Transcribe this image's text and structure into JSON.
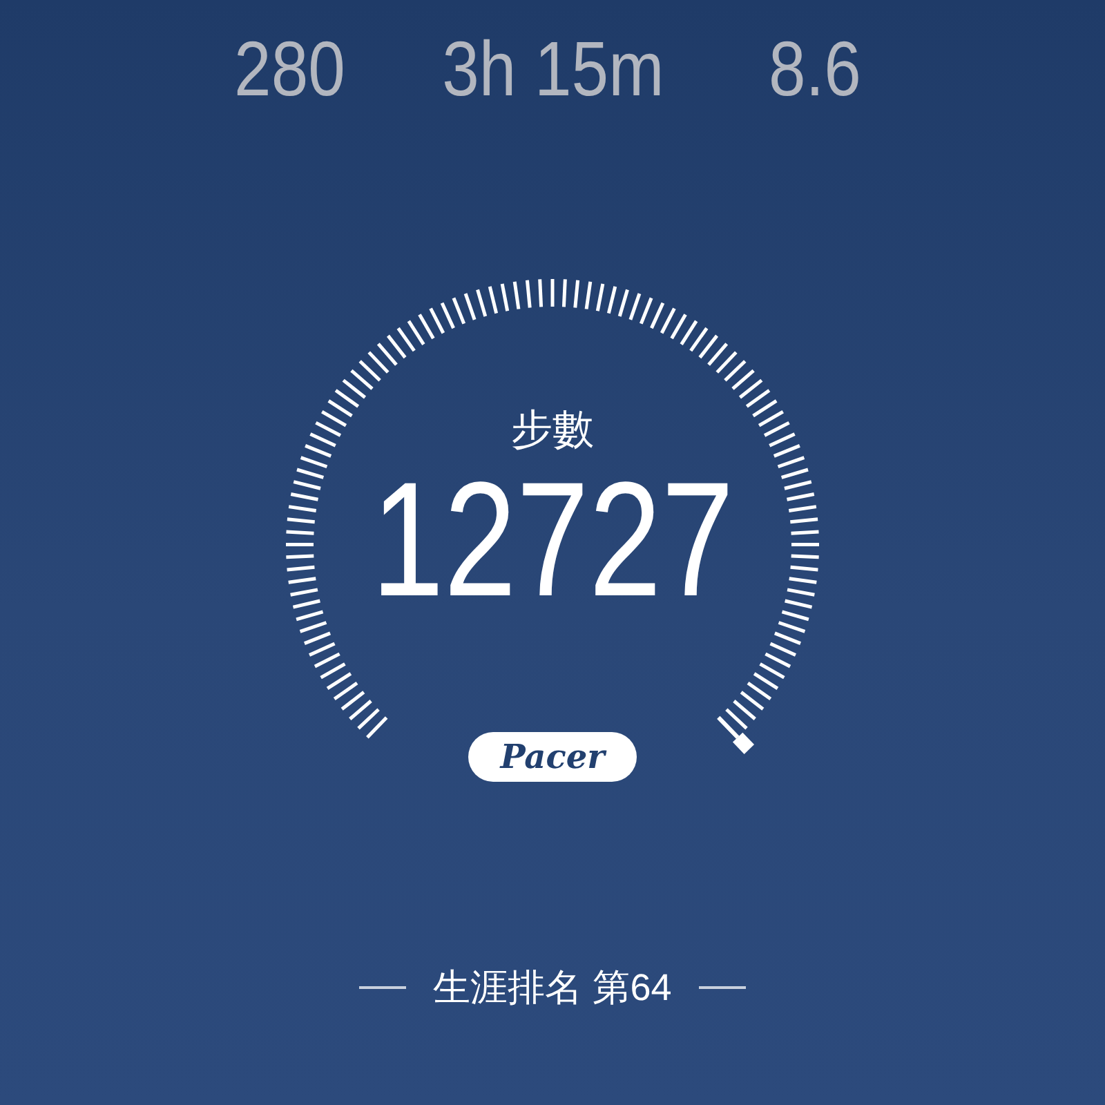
{
  "stats": [
    {
      "value": "280"
    },
    {
      "value": "3h 15m"
    },
    {
      "value": "8.6"
    }
  ],
  "gauge": {
    "label": "步數",
    "value": "12727"
  },
  "brand": {
    "logo": "Pacer"
  },
  "rank": {
    "text": "生涯排名 第64"
  }
}
